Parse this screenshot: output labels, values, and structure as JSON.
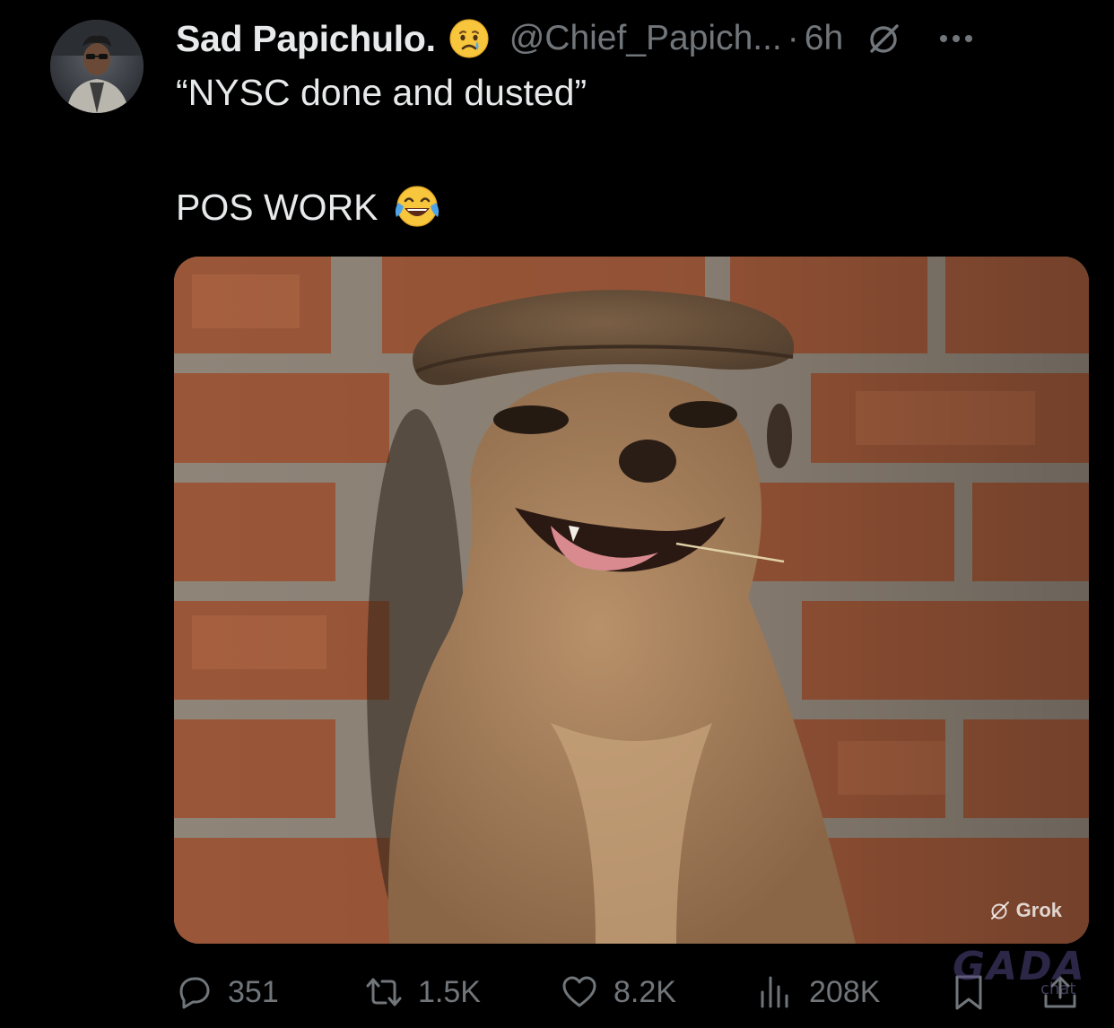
{
  "post": {
    "author": {
      "display_name": "Sad Papichulo.",
      "name_emoji": "crying-face-emoji",
      "handle": "@Chief_Papich...",
      "separator": "·",
      "time_ago": "6h"
    },
    "text": {
      "line1": "“NYSC done and dusted”",
      "line2": "POS WORK",
      "line2_emoji": "face-with-tears-of-joy-emoji"
    },
    "media": {
      "badge_label": "Grok"
    },
    "actions": {
      "replies": "351",
      "reposts": "1.5K",
      "likes": "8.2K",
      "views": "208K"
    }
  },
  "watermark": {
    "text": "GADA",
    "sub": "chat"
  },
  "colors": {
    "background": "#000000",
    "primary_text": "#e7e9ea",
    "secondary_text": "#71767b"
  }
}
